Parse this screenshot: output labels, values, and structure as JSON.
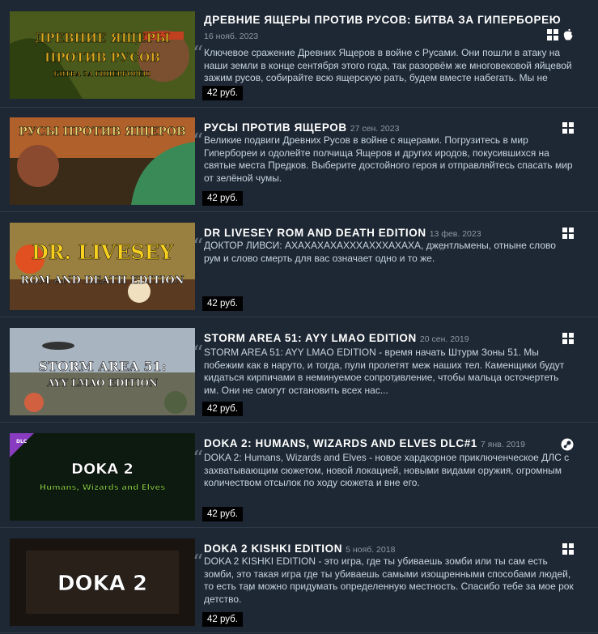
{
  "items": [
    {
      "title": "ДРЕВНИЕ ЯЩЕРЫ ПРОТИВ РУСОВ: БИТВА ЗА ГИПЕРБОРЕЮ",
      "date": "16 нояб. 2023",
      "description": "Ключевое сражение Древних Ящеров в войне с Русами. Они пошли в атаку на наши земли в конце сентября этого года, так разорвём же многовековой яйцевой зажим русов, собирайте всю ящерскую рать, будем вместе набегать. Мы не",
      "price": "42 руб.",
      "platforms": [
        "windows-icon",
        "apple-icon"
      ],
      "art_text": [
        "ДРЕВНИЕ ЯЩЕРЫ",
        "ПРОТИВ РУСОВ",
        "БИТВА ЗА ГИПЕРБОРЕЮ"
      ],
      "colors": {
        "bg": "#4a5a1c",
        "accent": "#d8a820"
      }
    },
    {
      "title": "РУСЫ ПРОТИВ ЯЩЕРОВ",
      "date": "27 сен. 2023",
      "description": "Великие подвиги Древних Русов в войне с ящерами. Погрузитесь в мир Гипербореи и одолейте полчища Ящеров и других иродов, покусившихся на святые места Предков. Выберите достойного героя и отправляйтесь спасать мир от зелёной чумы.",
      "price": "42 руб.",
      "platforms": [
        "windows-icon"
      ],
      "art_text": [
        "РУСЫ ПРОТИВ ЯЩЕРОВ"
      ],
      "colors": {
        "bg": "#b0602a",
        "accent": "#e8d070"
      }
    },
    {
      "title": "DR LIVESEY ROM AND DEATH EDITION",
      "date": "13 фев. 2023",
      "description": "ДОКТОР ЛИВСИ: АХАХАХАХАХХХАХХХАХАХА, джентльмены, отныне слово рум и слово смерть для вас означает одно и то же.",
      "price": "42 руб.",
      "platforms": [
        "windows-icon"
      ],
      "art_text": [
        "DR. LIVESEY",
        "ROM AND DEATH EDITION"
      ],
      "colors": {
        "bg": "#9a8040",
        "accent": "#f0c020"
      }
    },
    {
      "title": "STORM AREA 51: AYY LMAO EDITION",
      "date": "20 сен. 2019",
      "description": "STORM AREA 51: AYY LMAO EDITION - время начать Штурм Зоны 51. Мы побежим как в наруто, и тогда, пули пролетят меж наших тел. Каменщики будут кидаться кирпичами в неминуемое сопротивление, чтобы мальца осточертеть им. Они не смогут остановить всех нас...",
      "price": "42 руб.",
      "platforms": [
        "windows-icon"
      ],
      "art_text": [
        "STORM AREA 51:",
        "AYY LMAO EDITION"
      ],
      "colors": {
        "bg": "#8a96a4",
        "accent": "#ffffff"
      }
    },
    {
      "title": "DOKA 2: HUMANS, WIZARDS AND ELVES DLC#1",
      "date": "7 янв. 2019",
      "description": "DOKA 2: Humans, Wizards and Elves - новое хардкорное приключенческое ДЛС с захватывающим сюжетом, новой локацией, новыми видами оружия, огромным количеством отсылок по ходу сюжета и вне его.",
      "price": "42 руб.",
      "platforms": [
        "steam-icon"
      ],
      "art_text": [
        "DOKA 2",
        "Humans, Wizards and Elves"
      ],
      "dlc_badge": "DLC",
      "colors": {
        "bg": "#0c1a10",
        "accent": "#7cc040"
      }
    },
    {
      "title": "DOKA 2 KISHKI EDITION",
      "date": "5 нояб. 2018",
      "description": "DOKA 2 KISHKI EDITION - это игра, где ты убиваешь зомби или ты сам есть зомби, это такая игра где ты убиваешь самыми изощренными способами людей, то есть там можно придумать определенную местность. Спасибо тебе за мое рок детство.",
      "price": "42 руб.",
      "platforms": [
        "windows-icon"
      ],
      "art_text": [
        "DOKA 2"
      ],
      "colors": {
        "bg": "#1a1410",
        "accent": "#ffffff"
      }
    }
  ]
}
